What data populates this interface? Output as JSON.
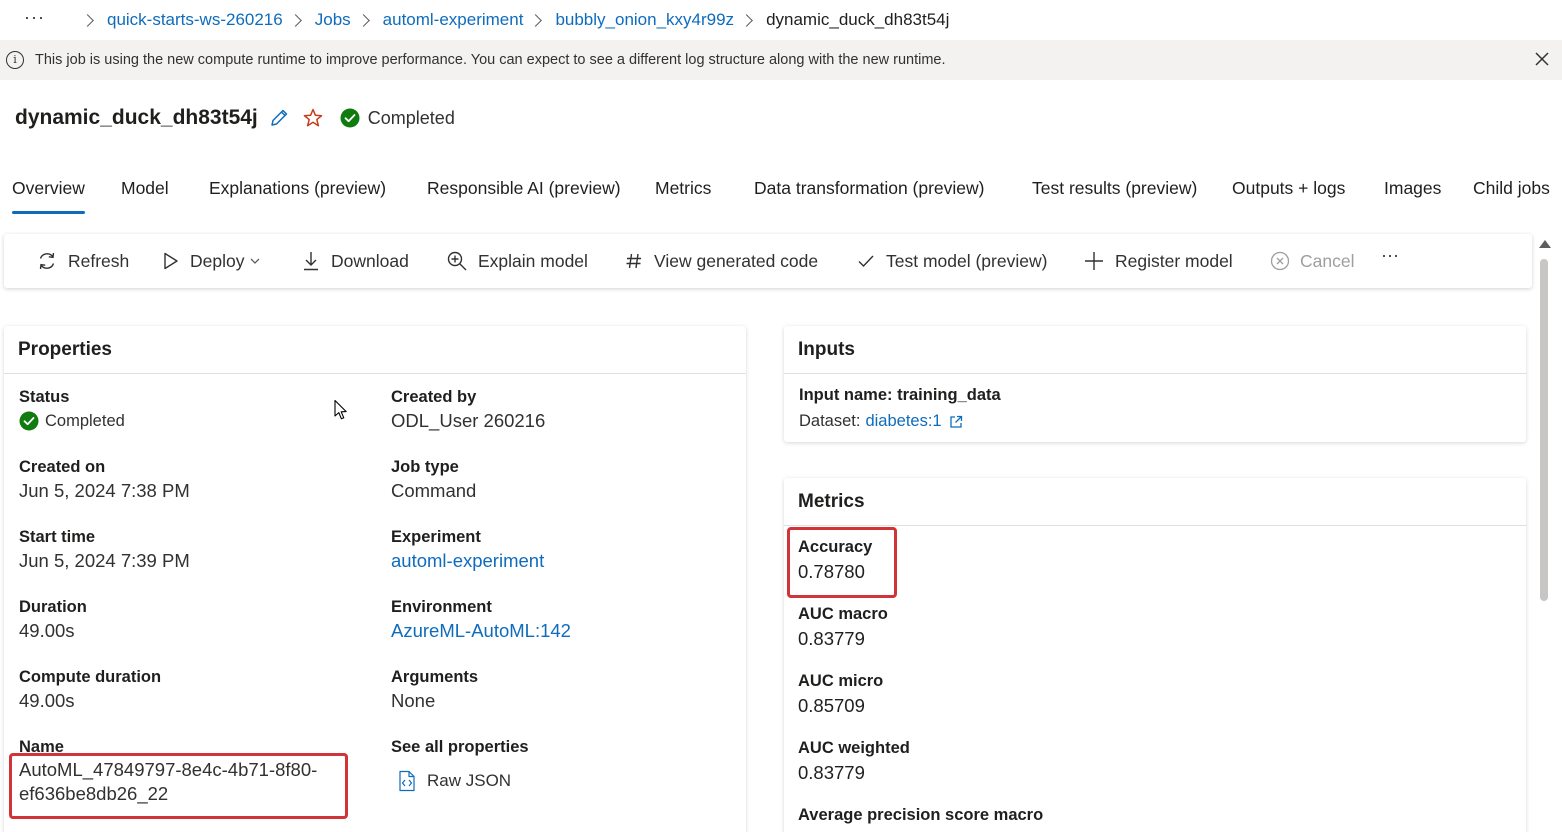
{
  "breadcrumb": {
    "more": "···",
    "items": [
      "quick-starts-ws-260216",
      "Jobs",
      "automl-experiment",
      "bubbly_onion_kxy4r99z"
    ],
    "current": "dynamic_duck_dh83t54j"
  },
  "banner": {
    "text": "This job is using the new compute runtime to improve performance. You can expect to see a different log structure along with the new runtime."
  },
  "job": {
    "title": "dynamic_duck_dh83t54j",
    "status": "Completed"
  },
  "tabs": [
    "Overview",
    "Model",
    "Explanations (preview)",
    "Responsible AI (preview)",
    "Metrics",
    "Data transformation (preview)",
    "Test results (preview)",
    "Outputs + logs",
    "Images",
    "Child jobs"
  ],
  "toolbar": {
    "refresh": "Refresh",
    "deploy": "Deploy",
    "download": "Download",
    "explain": "Explain model",
    "code": "View generated code",
    "test": "Test model (preview)",
    "register": "Register model",
    "cancel": "Cancel",
    "more": "···"
  },
  "properties": {
    "header": "Properties",
    "status_label": "Status",
    "status_value": "Completed",
    "created_on_label": "Created on",
    "created_on_value": "Jun 5, 2024 7:38 PM",
    "start_time_label": "Start time",
    "start_time_value": "Jun 5, 2024 7:39 PM",
    "duration_label": "Duration",
    "duration_value": "49.00s",
    "compute_duration_label": "Compute duration",
    "compute_duration_value": "49.00s",
    "name_label": "Name",
    "name_value_line1": "AutoML_47849797-8e4c-4b71-8f80-",
    "name_value_line2": "ef636be8db26_22",
    "created_by_label": "Created by",
    "created_by_value": "ODL_User 260216",
    "job_type_label": "Job type",
    "job_type_value": "Command",
    "experiment_label": "Experiment",
    "experiment_value": "automl-experiment",
    "environment_label": "Environment",
    "environment_value": "AzureML-AutoML:142",
    "arguments_label": "Arguments",
    "arguments_value": "None",
    "see_all_label": "See all properties",
    "raw_json": "Raw JSON"
  },
  "inputs": {
    "header": "Inputs",
    "input_name": "Input name: training_data",
    "dataset_label": "Dataset:",
    "dataset_link": "diabetes:1"
  },
  "metrics": {
    "header": "Metrics",
    "items": [
      {
        "label": "Accuracy",
        "value": "0.78780"
      },
      {
        "label": "AUC macro",
        "value": "0.83779"
      },
      {
        "label": "AUC micro",
        "value": "0.85709"
      },
      {
        "label": "AUC weighted",
        "value": "0.83779"
      },
      {
        "label": "Average precision score macro",
        "value": ""
      }
    ]
  },
  "colors": {
    "link": "#0f6cbd",
    "success": "#107c10",
    "highlight": "#d13438",
    "star": "#c43e1c"
  }
}
